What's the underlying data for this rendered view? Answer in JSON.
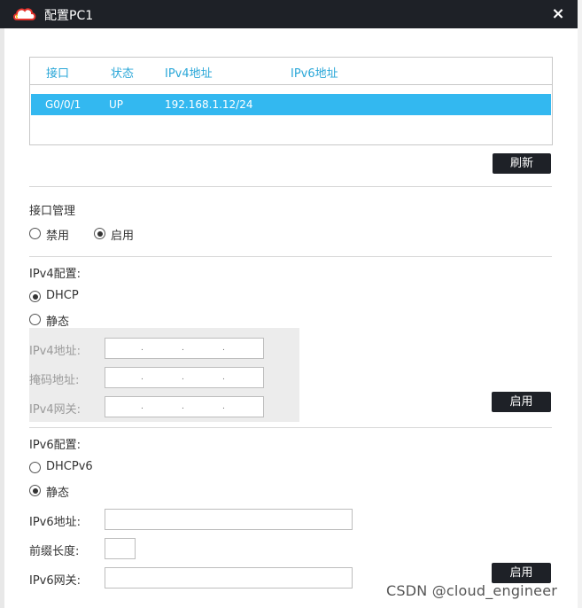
{
  "window": {
    "title": "配置PC1",
    "close_label": "×"
  },
  "interface_table": {
    "headers": [
      "接口",
      "状态",
      "IPv4地址",
      "IPv6地址"
    ],
    "rows": [
      {
        "interface": "G0/0/1",
        "status": "UP",
        "ipv4": "192.168.1.12/24",
        "ipv6": ""
      }
    ]
  },
  "refresh_button": "刷新",
  "interface_mgmt": {
    "title": "接口管理",
    "options": [
      "禁用",
      "启用"
    ],
    "selected": "启用"
  },
  "ipv4": {
    "title": "IPv4配置:",
    "options": [
      "DHCP",
      "静态"
    ],
    "selected": "DHCP",
    "fields": [
      {
        "label": "IPv4地址:",
        "value": ""
      },
      {
        "label": "掩码地址:",
        "value": ""
      },
      {
        "label": "IPv4网关:",
        "value": ""
      }
    ],
    "apply_button": "启用"
  },
  "ipv6": {
    "title": "IPv6配置:",
    "options": [
      "DHCPv6",
      "静态"
    ],
    "selected": "静态",
    "fields": [
      {
        "label": "IPv6地址:",
        "value": ""
      },
      {
        "label": "前缀长度:",
        "value": ""
      },
      {
        "label": "IPv6网关:",
        "value": ""
      }
    ],
    "apply_button": "启用"
  },
  "watermark": "CSDN @cloud_engineer",
  "colors": {
    "titlebar": "#1e2127",
    "accent": "#33b8f0",
    "header_text": "#2aa7d8"
  },
  "icons": {
    "logo": "cloud-logo-icon",
    "close": "close-icon"
  }
}
